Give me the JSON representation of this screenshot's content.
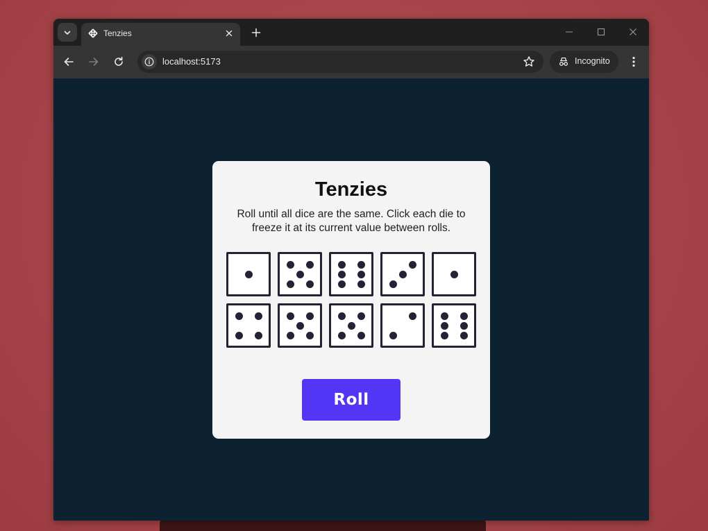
{
  "browser": {
    "tab_title": "Tenzies",
    "url": "localhost:5173",
    "incognito_label": "Incognito",
    "icons": {
      "tab_search": "chevron-down-icon",
      "favicon": "dice-icon",
      "tab_close": "close-icon",
      "new_tab": "plus-icon",
      "minimize": "minimize-icon",
      "maximize": "maximize-icon",
      "close_window": "close-icon",
      "back": "arrow-left-icon",
      "forward": "arrow-right-icon",
      "reload": "reload-icon",
      "site_info": "info-icon",
      "bookmark": "star-icon",
      "incognito": "incognito-icon",
      "menu": "more-vertical-icon"
    }
  },
  "game": {
    "title": "Tenzies",
    "instructions": "Roll until all dice are the same. Click each die to freeze it at its current value between rolls.",
    "dice": [
      1,
      5,
      6,
      3,
      1,
      4,
      5,
      5,
      2,
      6
    ],
    "roll_label": "Roll"
  },
  "colors": {
    "page_background": "#0c2231",
    "card_background": "#f4f4f4",
    "die_border": "#232336",
    "pip": "#232336",
    "roll_button": "#5235f5",
    "roll_text": "#ffffff"
  }
}
